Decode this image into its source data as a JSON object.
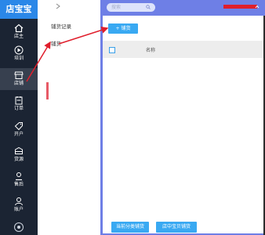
{
  "app": {
    "logo_text": "店宝宝"
  },
  "sidebar": {
    "items": [
      {
        "label": "店主",
        "icon": "home-icon"
      },
      {
        "label": "培训",
        "icon": "play-icon"
      },
      {
        "label": "店铺",
        "icon": "store-icon"
      },
      {
        "label": "订单",
        "icon": "orders-icon"
      },
      {
        "label": "开户",
        "icon": "tag-icon"
      },
      {
        "label": "货源",
        "icon": "box-icon"
      },
      {
        "label": "售后",
        "icon": "service-icon"
      },
      {
        "label": "账户",
        "icon": "account-icon"
      }
    ],
    "active_label": "店铺"
  },
  "subpanel": {
    "items": [
      {
        "label": "铺货记录"
      },
      {
        "label": "铺货"
      }
    ]
  },
  "topbar": {
    "search_placeholder": "搜索"
  },
  "main": {
    "add_button_label": "+ 铺货",
    "table": {
      "header_name": "名称"
    },
    "bottom_buttons": [
      {
        "label": "当前分类铺货"
      },
      {
        "label": "店中宝贝铺货"
      }
    ]
  },
  "colors": {
    "accent_blue": "#39a9f2",
    "topbar": "#6e7fe6",
    "sidebar_bg": "#1b2433",
    "highlight_red": "#e01e2c"
  }
}
